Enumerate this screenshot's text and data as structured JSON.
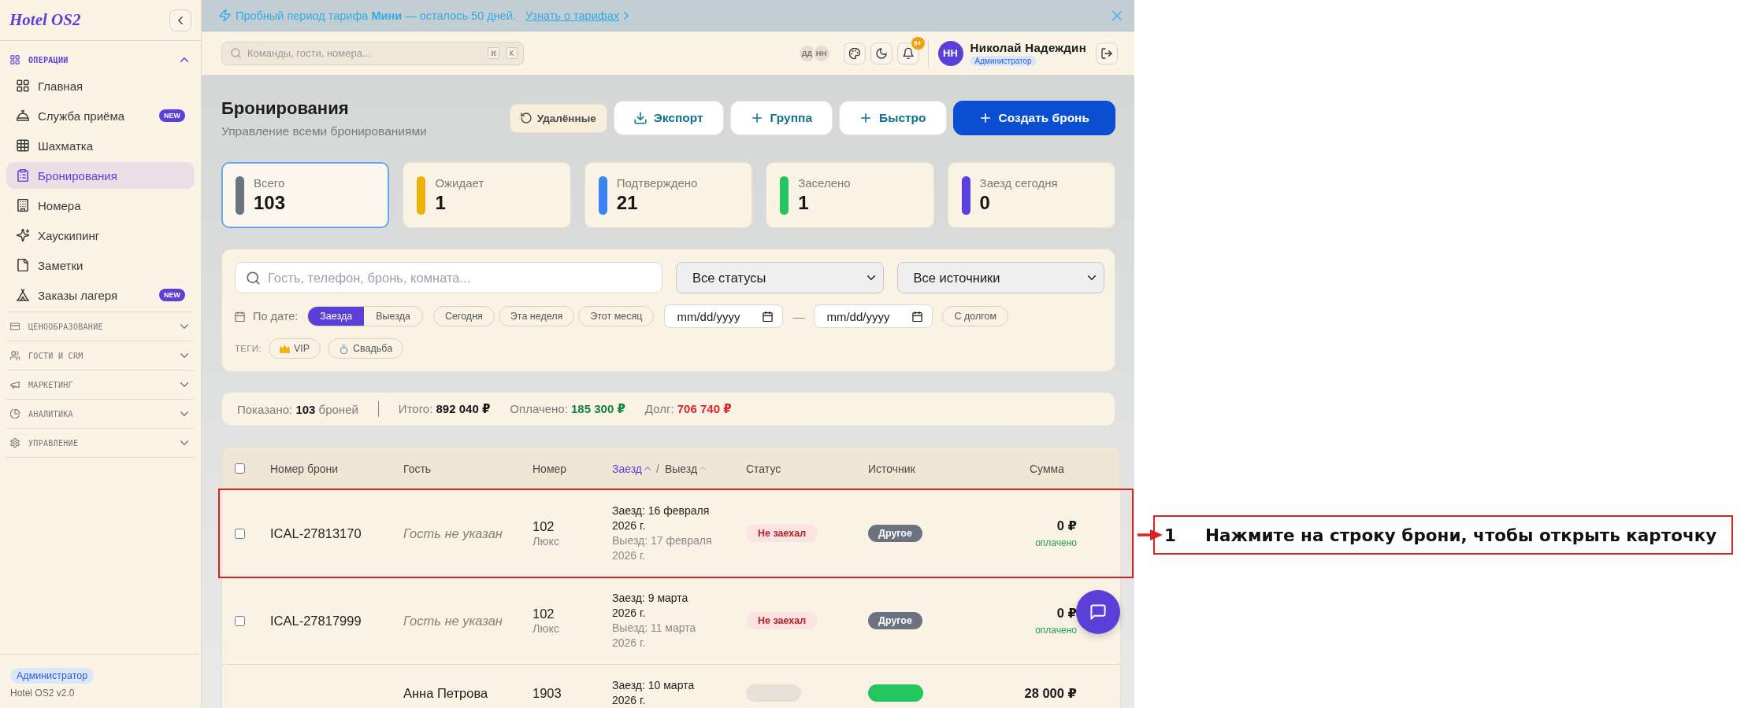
{
  "sidebar": {
    "logo": "Hotel OS2",
    "sections": [
      {
        "label": "ОПЕРАЦИИ",
        "expanded": true,
        "items": [
          {
            "label": "Главная",
            "selected": false
          },
          {
            "label": "Служба приёма",
            "selected": false,
            "badge": "NEW"
          },
          {
            "label": "Шахматка",
            "selected": false
          },
          {
            "label": "Бронирования",
            "selected": true
          },
          {
            "label": "Номера",
            "selected": false
          },
          {
            "label": "Хаускипинг",
            "selected": false
          },
          {
            "label": "Заметки",
            "selected": false
          },
          {
            "label": "Заказы лагеря",
            "selected": false,
            "badge": "NEW"
          }
        ]
      },
      {
        "label": "ЦЕНООБРАЗОВАНИЕ",
        "expanded": false
      },
      {
        "label": "ГОСТИ И CRM",
        "expanded": false
      },
      {
        "label": "МАРКЕТИНГ",
        "expanded": false
      },
      {
        "label": "АНАЛИТИКА",
        "expanded": false
      },
      {
        "label": "УПРАВЛЕНИЕ",
        "expanded": false
      }
    ],
    "role": "Администратор",
    "version": "Hotel OS2 v2.0"
  },
  "banner": {
    "text": "Пробный период тарифа **Мини** — осталось 50 дней.",
    "link": "Узнать о тарифах"
  },
  "topbar": {
    "search": {
      "placeholder": "Команды, гости, номера...",
      "keys": [
        "⌘",
        "K"
      ]
    },
    "presence": [
      "ДД",
      "НН"
    ],
    "notifications": "9+",
    "user": {
      "initials": "НН",
      "name": "Николай Надеждин",
      "role": "Администратор"
    }
  },
  "header": {
    "title": "Бронирования",
    "subtitle": "Управление всеми бронированиями",
    "actions": [
      {
        "kind": "restore",
        "label": "Удалённые"
      },
      {
        "kind": "export",
        "label": "Экспорт"
      },
      {
        "kind": "add",
        "label": "Группа"
      },
      {
        "kind": "add",
        "label": "Быстро"
      },
      {
        "kind": "primary",
        "label": "Создать бронь"
      }
    ]
  },
  "stats": [
    {
      "label": "Всего",
      "value": "103",
      "color": "#6b7280",
      "selected": true
    },
    {
      "label": "Ожидает",
      "value": "1",
      "color": "#eab308",
      "selected": false
    },
    {
      "label": "Подтверждено",
      "value": "21",
      "color": "#3b82f6",
      "selected": false
    },
    {
      "label": "Заселено",
      "value": "1",
      "color": "#22c55e",
      "selected": false
    },
    {
      "label": "Заезд сегодня",
      "value": "0",
      "color": "#5b3fe0",
      "selected": false
    }
  ],
  "filters": {
    "search": {
      "placeholder": "Гость, телефон, бронь, комната..."
    },
    "selects": [
      {
        "value": "Все статусы"
      },
      {
        "value": "Все источники"
      }
    ],
    "date_label": "По дате:",
    "date_modes": [
      {
        "label": "Заезда",
        "selected": true
      },
      {
        "label": "Выезда",
        "selected": false
      }
    ],
    "presets": [
      {
        "label": "Сегодня",
        "selected": false
      },
      {
        "label": "Эта неделя",
        "selected": false
      },
      {
        "label": "Этот месяц",
        "selected": false
      }
    ],
    "date_from": {
      "placeholder": "mm/dd/yyyy"
    },
    "date_separator": "—",
    "date_to": {
      "placeholder": "mm/dd/yyyy"
    },
    "debt_only": {
      "label": "С долгом",
      "selected": false
    },
    "tags_label": "ТЕГИ:",
    "tags": [
      {
        "label": "VIP",
        "selected": false
      },
      {
        "label": "Свадьба",
        "selected": false
      }
    ]
  },
  "summary": [
    {
      "kind": "count",
      "text": "Показано: **103** броней"
    },
    {
      "kind": "total",
      "text": "Итого: **892 040 ₽**"
    },
    {
      "kind": "paid",
      "text": "Оплачено: **185 300 ₽**"
    },
    {
      "kind": "debt",
      "text": "Долг: **706 740 ₽**"
    }
  ],
  "table": {
    "select_all": {
      "checked": false
    },
    "columns": [
      {
        "kind": "text",
        "label": "Номер брони"
      },
      {
        "kind": "text",
        "label": "Гость"
      },
      {
        "kind": "text",
        "label": "Номер"
      },
      {
        "kind": "sort",
        "parts": [
          {
            "label": "Заезд",
            "selected": true
          },
          {
            "label": "Выезд",
            "selected": false
          }
        ],
        "separator": "/"
      },
      {
        "kind": "text",
        "label": "Статус"
      },
      {
        "kind": "text",
        "label": "Источник"
      },
      {
        "kind": "amount",
        "label": "Сумма"
      }
    ],
    "rows": [
      {
        "checked": false,
        "highlighted": true,
        "booking": "ICAL-27813170",
        "guest": "Гость не указан",
        "guest_missing": true,
        "room": "102",
        "room_type": "Люкс",
        "checkin": "Заезд: 16 февраля 2026 г.",
        "checkout": "Выезд: 17 февраля 2026 г.",
        "status": {
          "label": "Не заехал",
          "color": "#fde2e4"
        },
        "source": {
          "label": "Другое",
          "color": "#6b7280"
        },
        "amount": "0 ₽",
        "payment": "оплачено"
      },
      {
        "checked": false,
        "highlighted": false,
        "booking": "ICAL-27817999",
        "guest": "Гость не указан",
        "guest_missing": true,
        "room": "102",
        "room_type": "Люкс",
        "checkin": "Заезд: 9 марта 2026 г.",
        "checkout": "Выезд: 11 марта 2026 г.",
        "status": {
          "label": "Не заехал",
          "color": "#fde2e4"
        },
        "source": {
          "label": "Другое",
          "color": "#6b7280"
        },
        "amount": "0 ₽",
        "payment": "оплачено"
      },
      {
        "highlighted": false,
        "guest": "Анна Петрова",
        "guest_missing": false,
        "room": "1903",
        "checkin": "Заезд: 10 марта 2026 г.",
        "status": {
          "color": "#e6e0d8"
        },
        "source": {
          "color": "#22c55e"
        },
        "amount": "28 000 ₽"
      }
    ]
  },
  "annotation": {
    "number": "1",
    "text": "Нажмите на строку брони, чтобы открыть карточку"
  }
}
